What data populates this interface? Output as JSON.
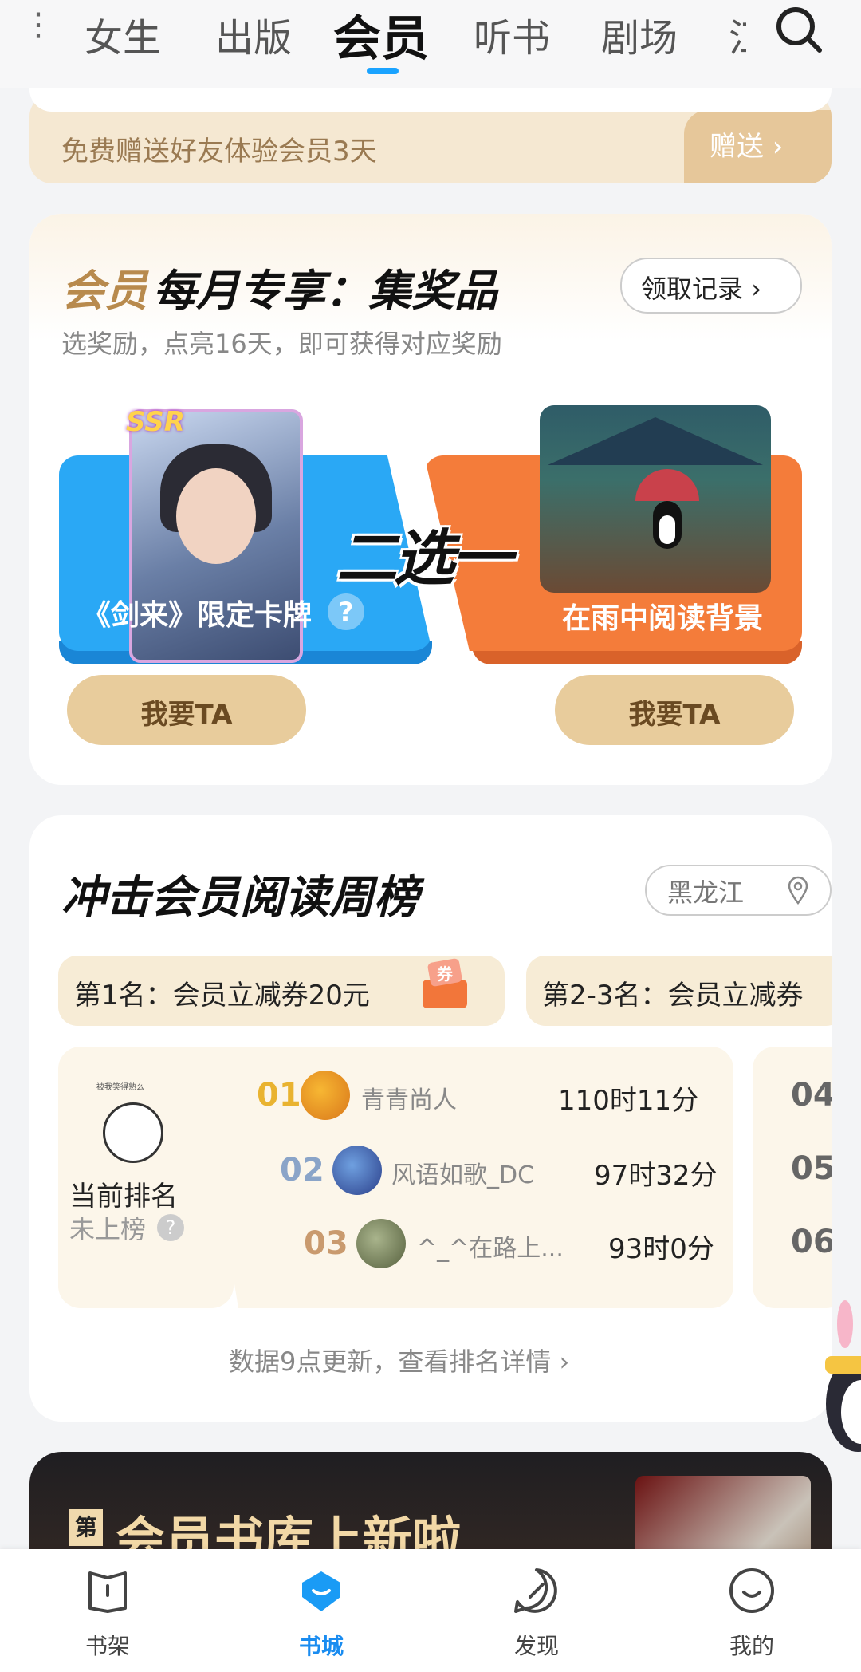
{
  "top_nav": {
    "tabs": [
      {
        "label": "女生"
      },
      {
        "label": "出版"
      },
      {
        "label": "会员",
        "active": true
      },
      {
        "label": "听书"
      },
      {
        "label": "剧场"
      },
      {
        "label": "江"
      }
    ],
    "more_icon": "more-dots-icon",
    "search_icon": "search-icon",
    "accent_color": "#1aa3ff"
  },
  "gift_strip": {
    "text": "免费赠送好友体验会员3天",
    "button_label": "赠送"
  },
  "monthly_reward": {
    "title_prefix": "会员",
    "title_rest": "每月专享：集奖品",
    "subtitle": "选奖励，点亮16天，即可获得对应奖励",
    "record_label": "领取记录",
    "divider_text": "二选一",
    "options": [
      {
        "label": "《剑来》限定卡牌",
        "badge": "SSR",
        "help": "?",
        "button": "我要TA"
      },
      {
        "label": "在雨中阅读背景",
        "button": "我要TA"
      }
    ]
  },
  "weekly_rank": {
    "title": "冲击会员阅读周榜",
    "region": "黑龙江",
    "prizes": [
      {
        "label": "第1名：会员立减券20元",
        "icon": "coupon-gift-icon",
        "icon_text": "券"
      },
      {
        "label": "第2-3名：会员立减券"
      }
    ],
    "current": {
      "avatar_caption": "被我笑得熟么",
      "label": "当前排名",
      "status": "未上榜",
      "help": "?"
    },
    "rows": [
      {
        "rank": "01",
        "name": "青青尚人",
        "time": "110时11分",
        "color": "#e9b330"
      },
      {
        "rank": "02",
        "name": "风语如歌_DC",
        "time": "97时32分",
        "color": "#8aa4c8"
      },
      {
        "rank": "03",
        "name": "^_^在路上...",
        "time": "93时0分",
        "color": "#c99a6e"
      }
    ],
    "side_ranks": [
      "04",
      "05",
      "06"
    ],
    "update_text": "数据9点更新，查看排名详情"
  },
  "banner": {
    "number_label": "第",
    "text": "会员书库上新啦"
  },
  "tabbar": {
    "items": [
      {
        "label": "书架",
        "icon": "bookshelf-icon"
      },
      {
        "label": "书城",
        "icon": "bookstore-icon",
        "active": true
      },
      {
        "label": "发现",
        "icon": "compass-icon"
      },
      {
        "label": "我的",
        "icon": "smile-icon"
      }
    ]
  }
}
